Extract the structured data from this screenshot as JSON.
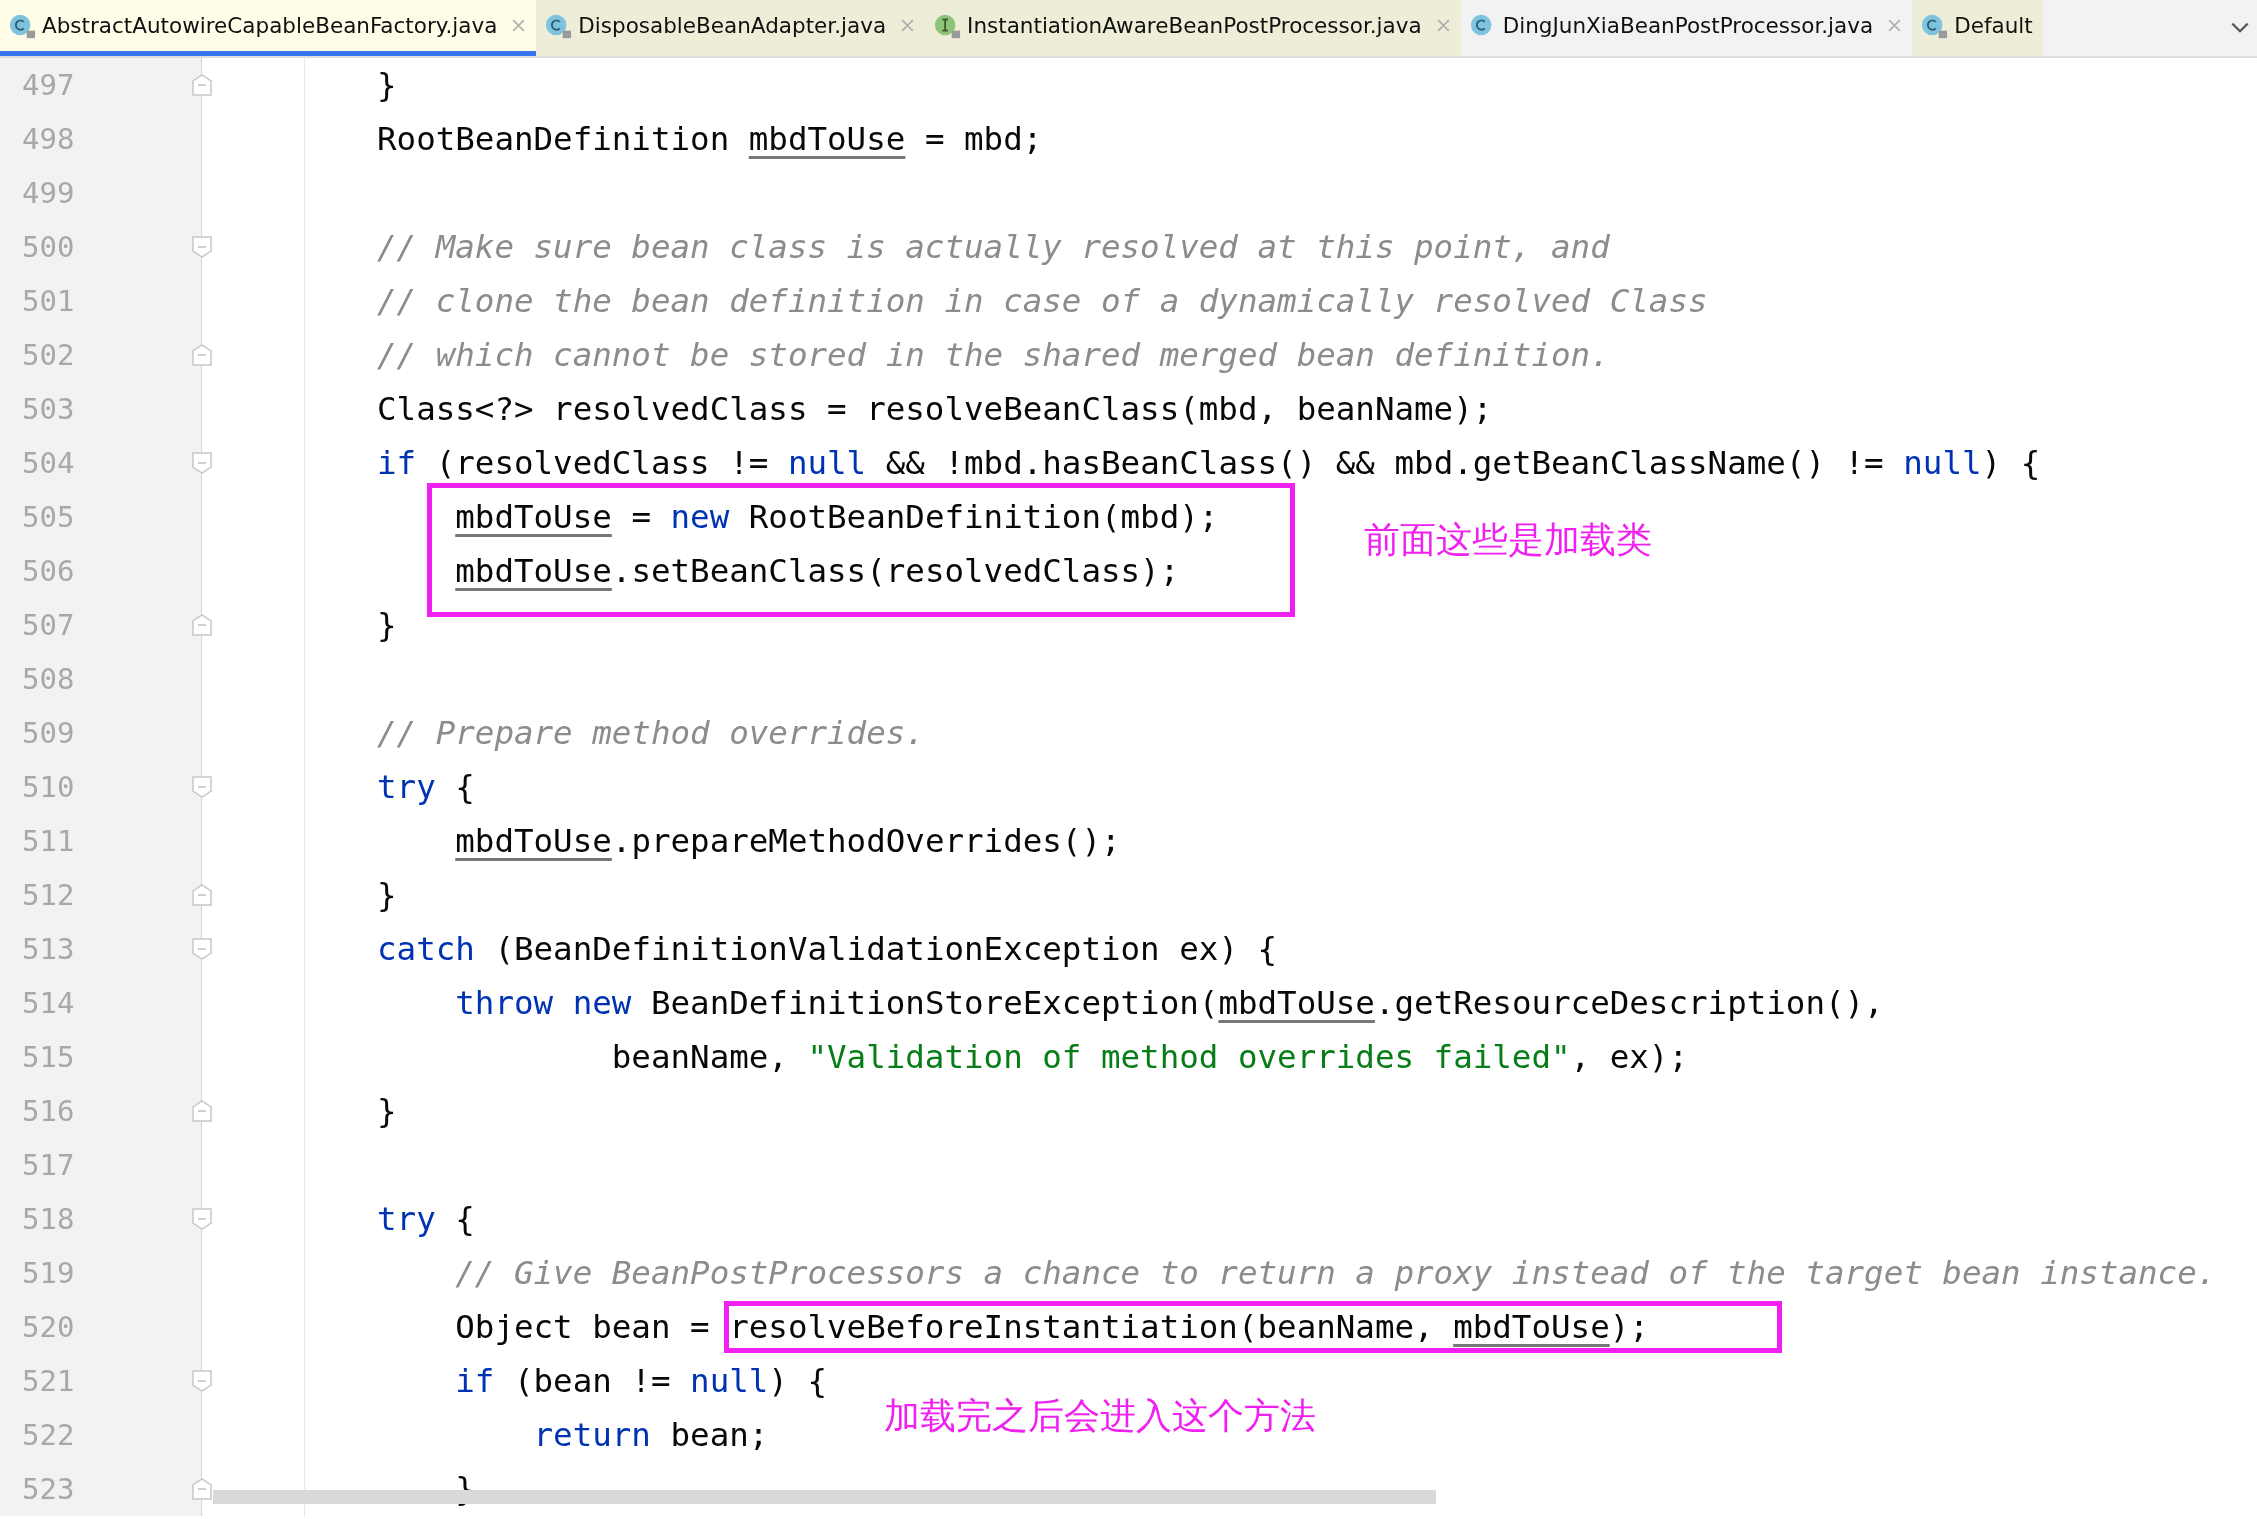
{
  "tabs": [
    {
      "label": "AbstractAutowireCapableBeanFactory.java",
      "kind": "class",
      "locked": true,
      "selected": true,
      "closable": true
    },
    {
      "label": "DisposableBeanAdapter.java",
      "kind": "class",
      "locked": true,
      "selected": false,
      "closable": true
    },
    {
      "label": "InstantiationAwareBeanPostProcessor.java",
      "kind": "interface",
      "locked": true,
      "selected": false,
      "closable": true
    },
    {
      "label": "DingJunXiaBeanPostProcessor.java",
      "kind": "class",
      "locked": false,
      "selected": false,
      "closable": true
    },
    {
      "label": "Default",
      "kind": "class",
      "locked": true,
      "selected": false,
      "closable": false
    }
  ],
  "lines": [
    {
      "number": "497",
      "fold_start": false,
      "fold_end": true,
      "tokens": [
        {
          "kind": "plain",
          "text": "}"
        }
      ]
    },
    {
      "number": "498",
      "fold_start": false,
      "fold_end": false,
      "tokens": [
        {
          "kind": "plain",
          "text": "RootBeanDefinition "
        },
        {
          "kind": "var",
          "text": "mbdToUse"
        },
        {
          "kind": "plain",
          "text": " = mbd;"
        }
      ]
    },
    {
      "number": "499",
      "fold_start": false,
      "fold_end": false
    },
    {
      "number": "500",
      "fold_start": true,
      "fold_end": false,
      "tokens": [
        {
          "kind": "comment",
          "text": "// Make sure bean class is actually resolved at this point, and"
        }
      ]
    },
    {
      "number": "501",
      "fold_start": false,
      "fold_end": false,
      "tokens": [
        {
          "kind": "comment",
          "text": "// clone the bean definition in case of a dynamically resolved Class"
        }
      ]
    },
    {
      "number": "502",
      "fold_start": false,
      "fold_end": true,
      "tokens": [
        {
          "kind": "comment",
          "text": "// which cannot be stored in the shared merged bean definition."
        }
      ]
    },
    {
      "number": "503",
      "fold_start": false,
      "fold_end": false,
      "tokens": [
        {
          "kind": "plain",
          "text": "Class<?> resolvedClass = resolveBeanClass(mbd, beanName);"
        }
      ]
    },
    {
      "number": "504",
      "fold_start": true,
      "fold_end": false,
      "tokens": [
        {
          "kind": "keyword",
          "text": "if"
        },
        {
          "kind": "plain",
          "text": " (resolvedClass != "
        },
        {
          "kind": "keyword",
          "text": "null"
        },
        {
          "kind": "plain",
          "text": " && !mbd.hasBeanClass() && mbd.getBeanClassName() != "
        },
        {
          "kind": "keyword",
          "text": "null"
        },
        {
          "kind": "plain",
          "text": ") {"
        }
      ]
    },
    {
      "number": "505",
      "fold_start": false,
      "fold_end": false,
      "tokens": [
        {
          "kind": "var",
          "text": "    mbdToUse"
        },
        {
          "kind": "plain",
          "text": " = "
        },
        {
          "kind": "keyword",
          "text": "new"
        },
        {
          "kind": "plain",
          "text": " RootBeanDefinition(mbd);"
        }
      ]
    },
    {
      "number": "506",
      "fold_start": false,
      "fold_end": false,
      "tokens": [
        {
          "kind": "var",
          "text": "    mbdToUse"
        },
        {
          "kind": "plain",
          "text": ".setBeanClass(resolvedClass);"
        }
      ]
    },
    {
      "number": "507",
      "fold_start": false,
      "fold_end": true,
      "tokens": [
        {
          "kind": "plain",
          "text": "}"
        }
      ]
    },
    {
      "number": "508",
      "fold_start": false,
      "fold_end": false
    },
    {
      "number": "509",
      "fold_start": false,
      "fold_end": false,
      "tokens": [
        {
          "kind": "comment",
          "text": "// Prepare method overrides."
        }
      ]
    },
    {
      "number": "510",
      "fold_start": true,
      "fold_end": false,
      "tokens": [
        {
          "kind": "keyword",
          "text": "try"
        },
        {
          "kind": "plain",
          "text": " {"
        }
      ]
    },
    {
      "number": "511",
      "fold_start": false,
      "fold_end": false,
      "tokens": [
        {
          "kind": "var",
          "text": "    mbdToUse"
        },
        {
          "kind": "plain",
          "text": ".prepareMethodOverrides();"
        }
      ]
    },
    {
      "number": "512",
      "fold_start": false,
      "fold_end": true,
      "tokens": [
        {
          "kind": "plain",
          "text": "}"
        }
      ]
    },
    {
      "number": "513",
      "fold_start": true,
      "fold_end": false,
      "tokens": [
        {
          "kind": "keyword",
          "text": "catch"
        },
        {
          "kind": "plain",
          "text": " (BeanDefinitionValidationException ex) {"
        }
      ]
    },
    {
      "number": "514",
      "fold_start": false,
      "fold_end": false,
      "tokens": [
        {
          "kind": "keyword",
          "text": "    throw"
        },
        {
          "kind": "keyword",
          "text": " new"
        },
        {
          "kind": "plain",
          "text": " BeanDefinitionStoreException("
        },
        {
          "kind": "var",
          "text": "mbdToUse"
        },
        {
          "kind": "plain",
          "text": ".getResourceDescription(),"
        }
      ]
    },
    {
      "number": "515",
      "fold_start": false,
      "fold_end": false,
      "tokens": [
        {
          "kind": "plain",
          "text": "            beanName, "
        },
        {
          "kind": "string",
          "text": "\"Validation of method overrides failed\""
        },
        {
          "kind": "plain",
          "text": ", ex);"
        }
      ]
    },
    {
      "number": "516",
      "fold_start": false,
      "fold_end": true,
      "tokens": [
        {
          "kind": "plain",
          "text": "}"
        }
      ]
    },
    {
      "number": "517",
      "fold_start": false,
      "fold_end": false
    },
    {
      "number": "518",
      "fold_start": true,
      "fold_end": false,
      "tokens": [
        {
          "kind": "keyword",
          "text": "try"
        },
        {
          "kind": "plain",
          "text": " {"
        }
      ]
    },
    {
      "number": "519",
      "fold_start": false,
      "fold_end": false,
      "tokens": [
        {
          "kind": "comment",
          "text": "    // Give BeanPostProcessors a chance to return a proxy instead of the target bean instance."
        }
      ]
    },
    {
      "number": "520",
      "fold_start": false,
      "fold_end": false,
      "tokens": [
        {
          "kind": "plain",
          "text": "    Object bean = ",
          "highlighted": false
        },
        {
          "kind": "plain",
          "text": "resolveBeforeInstantiation(beanName, ",
          "highlighted": true
        },
        {
          "kind": "var",
          "text": "mbdToUse",
          "highlighted": true
        },
        {
          "kind": "plain",
          "text": ");",
          "highlighted": true
        }
      ]
    },
    {
      "number": "521",
      "fold_start": true,
      "fold_end": false,
      "tokens": [
        {
          "kind": "keyword",
          "text": "    if"
        },
        {
          "kind": "plain",
          "text": " (bean != "
        },
        {
          "kind": "keyword",
          "text": "null"
        },
        {
          "kind": "plain",
          "text": ") {"
        }
      ]
    },
    {
      "number": "522",
      "fold_start": false,
      "fold_end": false,
      "tokens": [
        {
          "kind": "keyword",
          "text": "        return"
        },
        {
          "kind": "plain",
          "text": " bean;"
        }
      ]
    },
    {
      "number": "523",
      "fold_start": false,
      "fold_end": true,
      "tokens": [
        {
          "kind": "plain",
          "text": "    }"
        }
      ]
    }
  ],
  "annotations": [
    {
      "kind": "box"
    },
    {
      "kind": "note",
      "text": "前面这些是加载类"
    },
    {
      "kind": "note",
      "text": "加载完之后会进入这个方法"
    }
  ]
}
